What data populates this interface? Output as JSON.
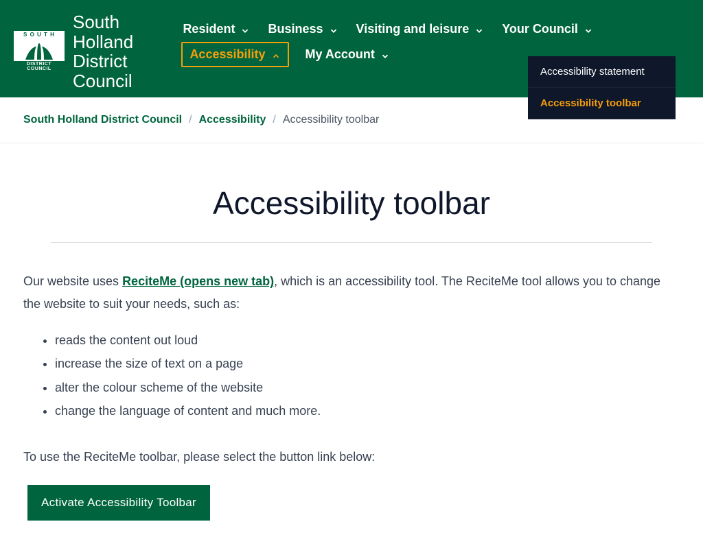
{
  "site": {
    "name_line1": "South Holland",
    "name_line2": "District Council"
  },
  "nav": {
    "items": [
      {
        "label": "Resident"
      },
      {
        "label": "Business"
      },
      {
        "label": "Visiting and leisure"
      },
      {
        "label": "Your Council"
      },
      {
        "label": "Accessibility"
      },
      {
        "label": "My Account"
      }
    ]
  },
  "dropdown": {
    "items": [
      {
        "label": "Accessibility statement"
      },
      {
        "label": "Accessibility toolbar"
      }
    ]
  },
  "breadcrumb": {
    "home": "South Holland District Council",
    "section": "Accessibility",
    "current": "Accessibility toolbar"
  },
  "page": {
    "title": "Accessibility toolbar",
    "intro_prefix": "Our website uses ",
    "intro_link": "ReciteMe (opens new tab)",
    "intro_suffix": ", which is an accessibility tool. The ReciteMe tool allows you to change the website to suit your needs, such as:",
    "features": [
      "reads the content out loud",
      "increase the size of text on a page",
      "alter the colour scheme of the website",
      "change the language of content and much more."
    ],
    "instruction": "To use the ReciteMe toolbar, please select the button link below:",
    "button": "Activate Accessibility Toolbar"
  }
}
